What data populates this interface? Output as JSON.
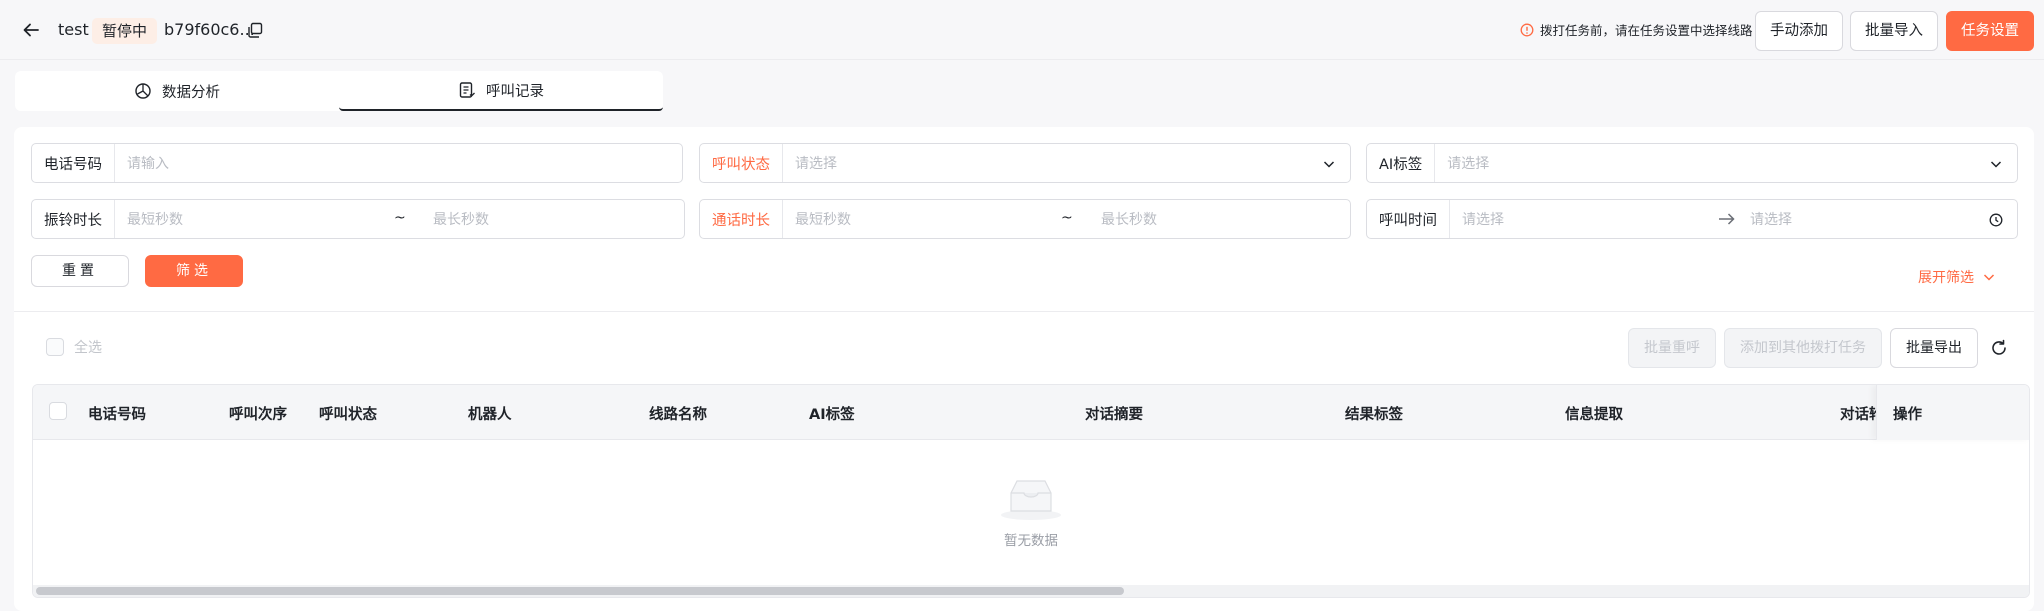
{
  "header": {
    "task_name": "test",
    "status": "暂停中",
    "task_id": "b79f60c6...",
    "tip": "拨打任务前，请在任务设置中选择线路",
    "manual_add": "手动添加",
    "batch_import": "批量导入",
    "task_settings": "任务设置"
  },
  "tabs": [
    {
      "label": "数据分析",
      "icon": "chart-pie-icon"
    },
    {
      "label": "呼叫记录",
      "icon": "record-list-icon"
    }
  ],
  "filters": {
    "phone": {
      "label": "电话号码",
      "placeholder": "请输入"
    },
    "call_status": {
      "label": "呼叫状态",
      "placeholder": "请选择"
    },
    "ai_tag": {
      "label": "AI标签",
      "placeholder": "请选择"
    },
    "ring_duration": {
      "label": "振铃时长",
      "min_placeholder": "最短秒数",
      "max_placeholder": "最长秒数"
    },
    "talk_duration": {
      "label": "通话时长",
      "min_placeholder": "最短秒数",
      "max_placeholder": "最长秒数"
    },
    "call_time": {
      "label": "呼叫时间",
      "start_placeholder": "请选择",
      "end_placeholder": "请选择"
    },
    "tilde": "~",
    "reset": "重置",
    "filter": "筛选",
    "expand": "展开筛选"
  },
  "toolbar": {
    "select_all": "全选",
    "batch_recall": "批量重呼",
    "add_to_other": "添加到其他拨打任务",
    "batch_export": "批量导出"
  },
  "table": {
    "columns": [
      "电话号码",
      "呼叫次序",
      "呼叫状态",
      "机器人",
      "线路名称",
      "AI标签",
      "对话摘要",
      "结果标签",
      "信息提取",
      "对话轮"
    ],
    "action_column": "操作",
    "empty_text": "暂无数据"
  },
  "colors": {
    "accent": "#ff6a43",
    "badge_bg": "#fdeee6"
  }
}
